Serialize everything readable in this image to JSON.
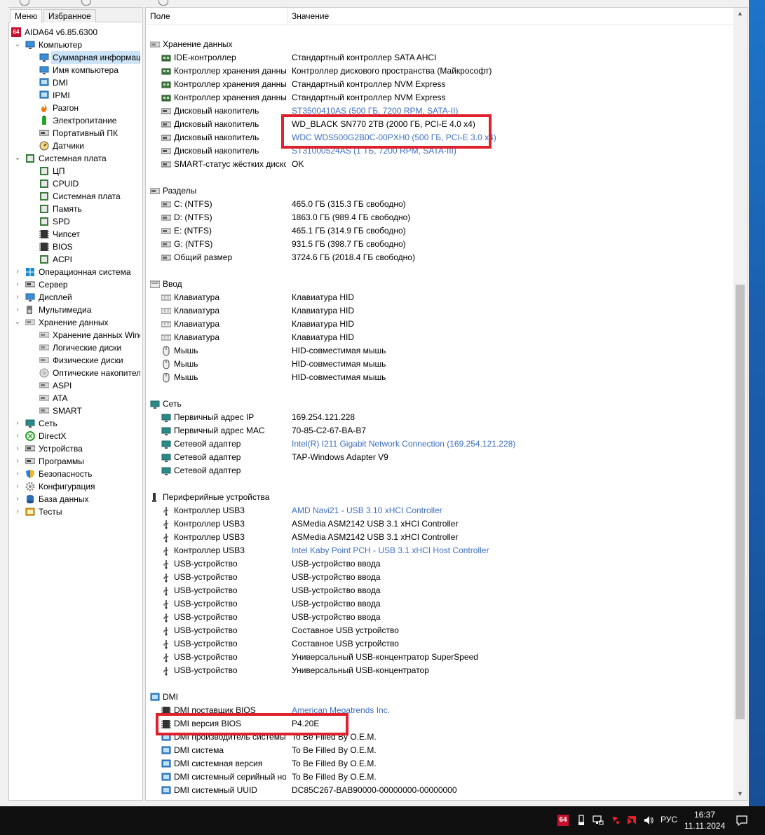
{
  "left_tabs": [
    "Меню",
    "Избранное"
  ],
  "tree": [
    {
      "label": "AIDA64 v6.85.6300",
      "depth": 0,
      "icon": "aida64-logo-icon",
      "arrow": ""
    },
    {
      "label": "Компьютер",
      "depth": 1,
      "icon": "computer-icon",
      "arrow": "v"
    },
    {
      "label": "Суммарная информация",
      "depth": 2,
      "icon": "summary-icon",
      "arrow": "",
      "selected": true
    },
    {
      "label": "Имя компьютера",
      "depth": 2,
      "icon": "computer-name-icon",
      "arrow": ""
    },
    {
      "label": "DMI",
      "depth": 2,
      "icon": "dmi-icon",
      "arrow": ""
    },
    {
      "label": "IPMI",
      "depth": 2,
      "icon": "ipmi-icon",
      "arrow": ""
    },
    {
      "label": "Разгон",
      "depth": 2,
      "icon": "overclock-flame-icon",
      "arrow": ""
    },
    {
      "label": "Электропитание",
      "depth": 2,
      "icon": "power-icon",
      "arrow": ""
    },
    {
      "label": "Портативный ПК",
      "depth": 2,
      "icon": "laptop-icon",
      "arrow": ""
    },
    {
      "label": "Датчики",
      "depth": 2,
      "icon": "sensor-gauge-icon",
      "arrow": ""
    },
    {
      "label": "Системная плата",
      "depth": 1,
      "icon": "motherboard-icon",
      "arrow": "v"
    },
    {
      "label": "ЦП",
      "depth": 2,
      "icon": "chip-icon",
      "arrow": ""
    },
    {
      "label": "CPUID",
      "depth": 2,
      "icon": "chip-icon",
      "arrow": ""
    },
    {
      "label": "Системная плата",
      "depth": 2,
      "icon": "chip-icon",
      "arrow": ""
    },
    {
      "label": "Память",
      "depth": 2,
      "icon": "memory-icon",
      "arrow": ""
    },
    {
      "label": "SPD",
      "depth": 2,
      "icon": "memory-icon",
      "arrow": ""
    },
    {
      "label": "Чипсет",
      "depth": 2,
      "icon": "chipset-icon",
      "arrow": ""
    },
    {
      "label": "BIOS",
      "depth": 2,
      "icon": "bios-icon",
      "arrow": ""
    },
    {
      "label": "ACPI",
      "depth": 2,
      "icon": "acpi-icon",
      "arrow": ""
    },
    {
      "label": "Операционная система",
      "depth": 1,
      "icon": "windows-icon",
      "arrow": ">"
    },
    {
      "label": "Сервер",
      "depth": 1,
      "icon": "server-icon",
      "arrow": ">"
    },
    {
      "label": "Дисплей",
      "depth": 1,
      "icon": "display-icon",
      "arrow": ">"
    },
    {
      "label": "Мультимедиа",
      "depth": 1,
      "icon": "speaker-icon",
      "arrow": ">"
    },
    {
      "label": "Хранение данных",
      "depth": 1,
      "icon": "storage-icon",
      "arrow": "v"
    },
    {
      "label": "Хранение данных Windows",
      "depth": 2,
      "icon": "storage-windows-icon",
      "arrow": ""
    },
    {
      "label": "Логические диски",
      "depth": 2,
      "icon": "logical-disk-icon",
      "arrow": ""
    },
    {
      "label": "Физические диски",
      "depth": 2,
      "icon": "physical-disk-icon",
      "arrow": ""
    },
    {
      "label": "Оптические накопители",
      "depth": 2,
      "icon": "optical-disc-icon",
      "arrow": ""
    },
    {
      "label": "ASPI",
      "depth": 2,
      "icon": "aspi-icon",
      "arrow": ""
    },
    {
      "label": "ATA",
      "depth": 2,
      "icon": "ata-icon",
      "arrow": ""
    },
    {
      "label": "SMART",
      "depth": 2,
      "icon": "smart-icon",
      "arrow": ""
    },
    {
      "label": "Сеть",
      "depth": 1,
      "icon": "network-icon",
      "arrow": ">"
    },
    {
      "label": "DirectX",
      "depth": 1,
      "icon": "xbox-icon",
      "arrow": ">"
    },
    {
      "label": "Устройства",
      "depth": 1,
      "icon": "devices-icon",
      "arrow": ">"
    },
    {
      "label": "Программы",
      "depth": 1,
      "icon": "programs-icon",
      "arrow": ">"
    },
    {
      "label": "Безопасность",
      "depth": 1,
      "icon": "shield-icon",
      "arrow": ">"
    },
    {
      "label": "Конфигурация",
      "depth": 1,
      "icon": "config-gear-icon",
      "arrow": ">"
    },
    {
      "label": "База данных",
      "depth": 1,
      "icon": "database-icon",
      "arrow": ">"
    },
    {
      "label": "Тесты",
      "depth": 1,
      "icon": "tests-icon",
      "arrow": ">"
    }
  ],
  "columns": {
    "field": "Поле",
    "value": "Значение"
  },
  "rows": [
    {
      "type": "blank"
    },
    {
      "type": "section",
      "field": "Хранение данных",
      "icon": "storage-icon"
    },
    {
      "field": "IDE-контроллер",
      "value": "Стандартный контроллер SATA AHCI",
      "icon": "controller-icon"
    },
    {
      "field": "Контроллер хранения данных",
      "value": "Контроллер дискового пространства (Майкрософт)",
      "icon": "controller-icon"
    },
    {
      "field": "Контроллер хранения данных",
      "value": "Стандартный контроллер NVM Express",
      "icon": "controller-icon"
    },
    {
      "field": "Контроллер хранения данных",
      "value": "Стандартный контроллер NVM Express",
      "icon": "controller-icon"
    },
    {
      "field": "Дисковый накопитель",
      "value": "ST3500410AS  (500 ГБ, 7200 RPM, SATA-II)",
      "icon": "disk-icon",
      "link": true
    },
    {
      "field": "Дисковый накопитель",
      "value": "WD_BLACK SN770 2TB  (2000 ГБ, PCI-E 4.0 x4)",
      "icon": "disk-icon"
    },
    {
      "field": "Дисковый накопитель",
      "value": "WDC WDS500G2B0C-00PXH0  (500 ГБ, PCI-E 3.0 x4)",
      "icon": "disk-icon",
      "link": true
    },
    {
      "field": "Дисковый накопитель",
      "value": "ST31000524AS  (1 ТБ, 7200 RPM, SATA-III)",
      "icon": "disk-icon",
      "link": true
    },
    {
      "field": "SMART-статус жёстких дисков",
      "value": "OK",
      "icon": "disk-icon"
    },
    {
      "type": "blank"
    },
    {
      "type": "section",
      "field": "Разделы",
      "icon": "partition-icon"
    },
    {
      "field": "C: (NTFS)",
      "value": "465.0 ГБ (315.3 ГБ свободно)",
      "icon": "partition-icon"
    },
    {
      "field": "D: (NTFS)",
      "value": "1863.0 ГБ (989.4 ГБ свободно)",
      "icon": "partition-icon"
    },
    {
      "field": "E: (NTFS)",
      "value": "465.1 ГБ (314.9 ГБ свободно)",
      "icon": "partition-icon"
    },
    {
      "field": "G: (NTFS)",
      "value": "931.5 ГБ (398.7 ГБ свободно)",
      "icon": "partition-icon"
    },
    {
      "field": "Общий размер",
      "value": "3724.6 ГБ (2018.4 ГБ свободно)",
      "icon": "partition-icon"
    },
    {
      "type": "blank"
    },
    {
      "type": "section",
      "field": "Ввод",
      "icon": "input-icon"
    },
    {
      "field": "Клавиатура",
      "value": "Клавиатура HID",
      "icon": "keyboard-icon"
    },
    {
      "field": "Клавиатура",
      "value": "Клавиатура HID",
      "icon": "keyboard-icon"
    },
    {
      "field": "Клавиатура",
      "value": "Клавиатура HID",
      "icon": "keyboard-icon"
    },
    {
      "field": "Клавиатура",
      "value": "Клавиатура HID",
      "icon": "keyboard-icon"
    },
    {
      "field": "Мышь",
      "value": "HID-совместимая мышь",
      "icon": "mouse-icon"
    },
    {
      "field": "Мышь",
      "value": "HID-совместимая мышь",
      "icon": "mouse-icon"
    },
    {
      "field": "Мышь",
      "value": "HID-совместимая мышь",
      "icon": "mouse-icon"
    },
    {
      "type": "blank"
    },
    {
      "type": "section",
      "field": "Сеть",
      "icon": "network-icon"
    },
    {
      "field": "Первичный адрес IP",
      "value": "169.254.121.228",
      "icon": "network-icon"
    },
    {
      "field": "Первичный адрес MAC",
      "value": "70-85-C2-67-BA-B7",
      "icon": "network-icon"
    },
    {
      "field": "Сетевой адаптер",
      "value": "Intel(R) I211 Gigabit Network Connection  (169.254.121.228)",
      "icon": "network-icon",
      "link": true
    },
    {
      "field": "Сетевой адаптер",
      "value": "TAP-Windows Adapter V9",
      "icon": "network-icon"
    },
    {
      "field": "Сетевой адаптер",
      "value": "",
      "icon": "network-icon"
    },
    {
      "type": "blank"
    },
    {
      "type": "section",
      "field": "Периферийные устройства",
      "icon": "peripherals-icon"
    },
    {
      "field": "Контроллер USB3",
      "value": "AMD Navi21 - USB 3.10 xHCI Controller",
      "icon": "usb-icon",
      "link": true
    },
    {
      "field": "Контроллер USB3",
      "value": "ASMedia ASM2142 USB 3.1 xHCI Controller",
      "icon": "usb-icon"
    },
    {
      "field": "Контроллер USB3",
      "value": "ASMedia ASM2142 USB 3.1 xHCI Controller",
      "icon": "usb-icon"
    },
    {
      "field": "Контроллер USB3",
      "value": "Intel Kaby Point PCH - USB 3.1 xHCI Host Controller",
      "icon": "usb-icon",
      "link": true
    },
    {
      "field": "USB-устройство",
      "value": "USB-устройство ввода",
      "icon": "usb-icon"
    },
    {
      "field": "USB-устройство",
      "value": "USB-устройство ввода",
      "icon": "usb-icon"
    },
    {
      "field": "USB-устройство",
      "value": "USB-устройство ввода",
      "icon": "usb-icon"
    },
    {
      "field": "USB-устройство",
      "value": "USB-устройство ввода",
      "icon": "usb-icon"
    },
    {
      "field": "USB-устройство",
      "value": "USB-устройство ввода",
      "icon": "usb-icon"
    },
    {
      "field": "USB-устройство",
      "value": "Составное USB устройство",
      "icon": "usb-icon"
    },
    {
      "field": "USB-устройство",
      "value": "Составное USB устройство",
      "icon": "usb-icon"
    },
    {
      "field": "USB-устройство",
      "value": "Универсальный USB-концентратор SuperSpeed",
      "icon": "usb-icon"
    },
    {
      "field": "USB-устройство",
      "value": "Универсальный USB-концентратор",
      "icon": "usb-icon"
    },
    {
      "type": "blank"
    },
    {
      "type": "section",
      "field": "DMI",
      "icon": "dmi-icon"
    },
    {
      "field": "DMI поставщик BIOS",
      "value": "American Megatrends Inc.",
      "icon": "bios-icon",
      "link": true
    },
    {
      "field": "DMI версия BIOS",
      "value": "P4.20E",
      "icon": "bios-icon"
    },
    {
      "field": "DMI производитель системы",
      "value": "To Be Filled By O.E.M.",
      "icon": "dmi-icon"
    },
    {
      "field": "DMI система",
      "value": "To Be Filled By O.E.M.",
      "icon": "dmi-icon"
    },
    {
      "field": "DMI системная версия",
      "value": "To Be Filled By O.E.M.",
      "icon": "dmi-icon"
    },
    {
      "field": "DMI системный серийный номер",
      "value": "To Be Filled By O.E.M.",
      "icon": "dmi-icon"
    },
    {
      "field": "DMI системный UUID",
      "value": "DC85C267-BAB90000-00000000-00000000",
      "icon": "dmi-icon"
    }
  ],
  "taskbar": {
    "lang": "РУС",
    "time": "16:37",
    "date": "11.11.2024",
    "tray": [
      "aida64-tray-icon",
      "usb-eject-icon",
      "network-tray-icon",
      "amd-tray-icon",
      "amd-radeon-icon",
      "volume-icon"
    ],
    "notifications_icon": "notifications-icon"
  }
}
